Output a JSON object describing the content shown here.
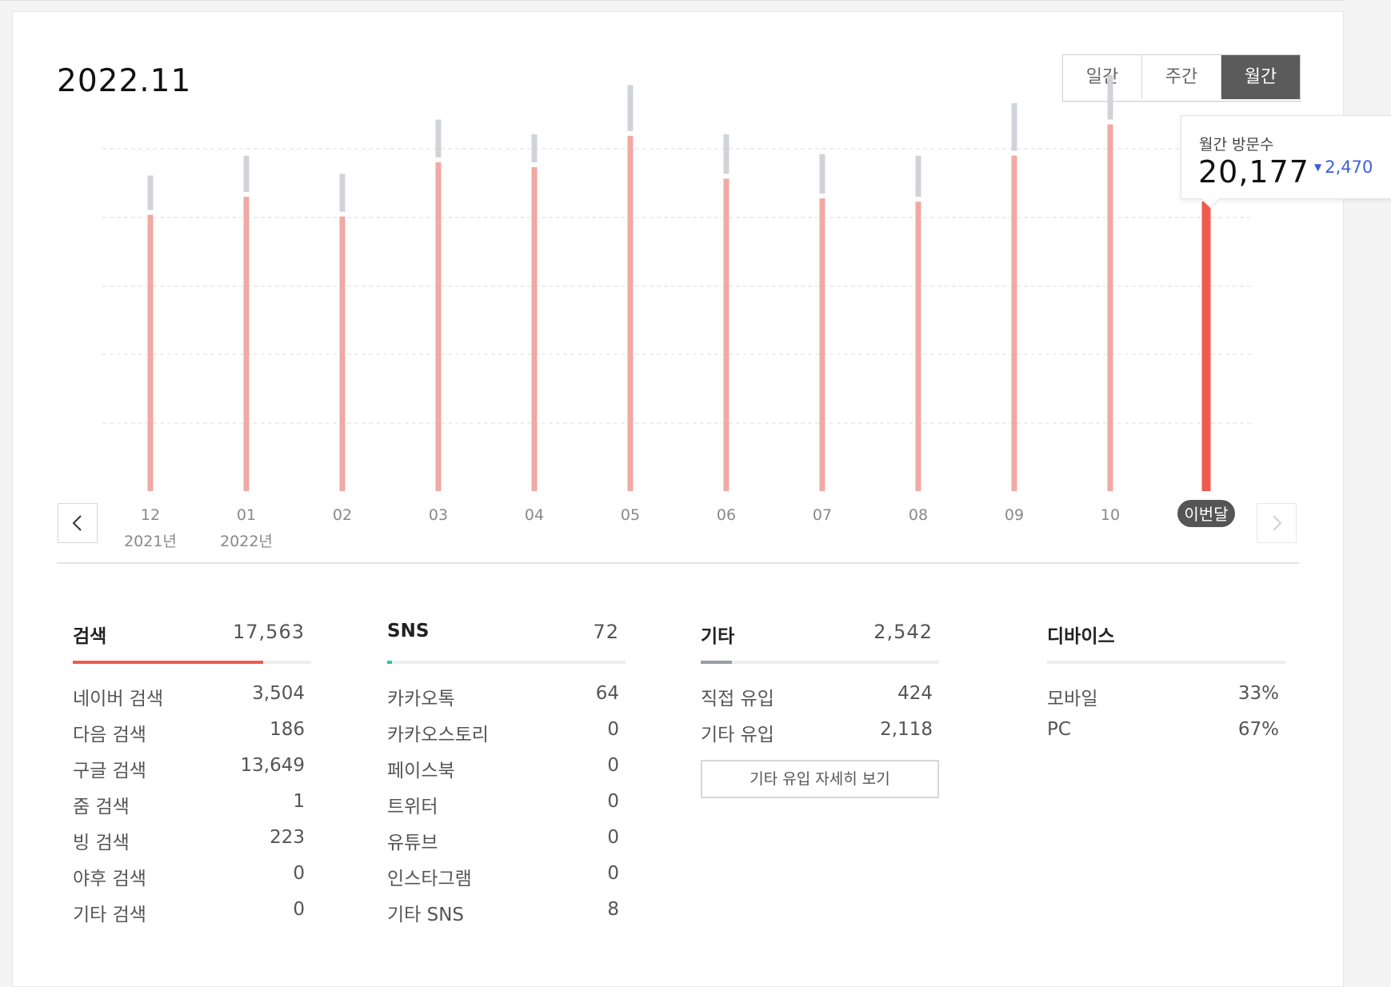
{
  "header": {
    "date": "2022.11",
    "period_tabs": [
      {
        "label": "일간",
        "active": false
      },
      {
        "label": "주간",
        "active": false
      },
      {
        "label": "월간",
        "active": true
      }
    ]
  },
  "tooltip": {
    "label": "월간 방문수",
    "value": "20,177",
    "change": "2,470",
    "change_direction": "down",
    "change_color": "#3b5fd9"
  },
  "nav": {
    "prev_icon": "chevron-left-icon",
    "next_icon": "chevron-right-icon"
  },
  "chart_data": {
    "type": "bar",
    "stacked": true,
    "grid": true,
    "categories": [
      "12",
      "01",
      "02",
      "03",
      "04",
      "05",
      "06",
      "07",
      "08",
      "09",
      "10",
      "이번달"
    ],
    "year_labels": [
      "2021년",
      "2022년",
      "",
      "",
      "",
      "",
      "",
      "",
      "",
      "",
      "",
      ""
    ],
    "series": [
      {
        "values": [
          16800,
          17900,
          16700,
          20000,
          19700,
          21600,
          19000,
          17800,
          17600,
          20400,
          22300,
          17600
        ],
        "color": "#f2a9a3",
        "highlight_color": "#ef5b4d"
      },
      {
        "values": [
          2100,
          2200,
          2300,
          2300,
          1700,
          2800,
          2400,
          2400,
          2500,
          2900,
          2700,
          2100
        ],
        "color": "#d0d3d7",
        "highlight_color": "#9ba3ae"
      }
    ],
    "highlight_index": 11,
    "current_total": 20177,
    "ylim": [
      0,
      25000
    ]
  },
  "stats": {
    "search": {
      "title": "검색",
      "total": "17,563",
      "share": 0.8,
      "color": "#ef5b4d",
      "rows": [
        {
          "label": "네이버 검색",
          "value": "3,504"
        },
        {
          "label": "다음 검색",
          "value": "186"
        },
        {
          "label": "구글 검색",
          "value": "13,649"
        },
        {
          "label": "줌 검색",
          "value": "1"
        },
        {
          "label": "빙 검색",
          "value": "223"
        },
        {
          "label": "야후 검색",
          "value": "0"
        },
        {
          "label": "기타 검색",
          "value": "0"
        }
      ]
    },
    "sns": {
      "title": "SNS",
      "total": "72",
      "share": 0.02,
      "color": "#2fc4a6",
      "rows": [
        {
          "label": "카카오톡",
          "value": "64"
        },
        {
          "label": "카카오스토리",
          "value": "0"
        },
        {
          "label": "페이스북",
          "value": "0"
        },
        {
          "label": "트위터",
          "value": "0"
        },
        {
          "label": "유튜브",
          "value": "0"
        },
        {
          "label": "인스타그램",
          "value": "0"
        },
        {
          "label": "기타 SNS",
          "value": "8"
        }
      ]
    },
    "etc": {
      "title": "기타",
      "total": "2,542",
      "share": 0.13,
      "color": "#999ea6",
      "rows": [
        {
          "label": "직접 유입",
          "value": "424"
        },
        {
          "label": "기타 유입",
          "value": "2,118"
        }
      ],
      "detail_button": "기타 유입 자세히 보기"
    },
    "device": {
      "title": "디바이스",
      "rows": [
        {
          "label": "모바일",
          "value": "33%"
        },
        {
          "label": "PC",
          "value": "67%"
        }
      ]
    }
  }
}
